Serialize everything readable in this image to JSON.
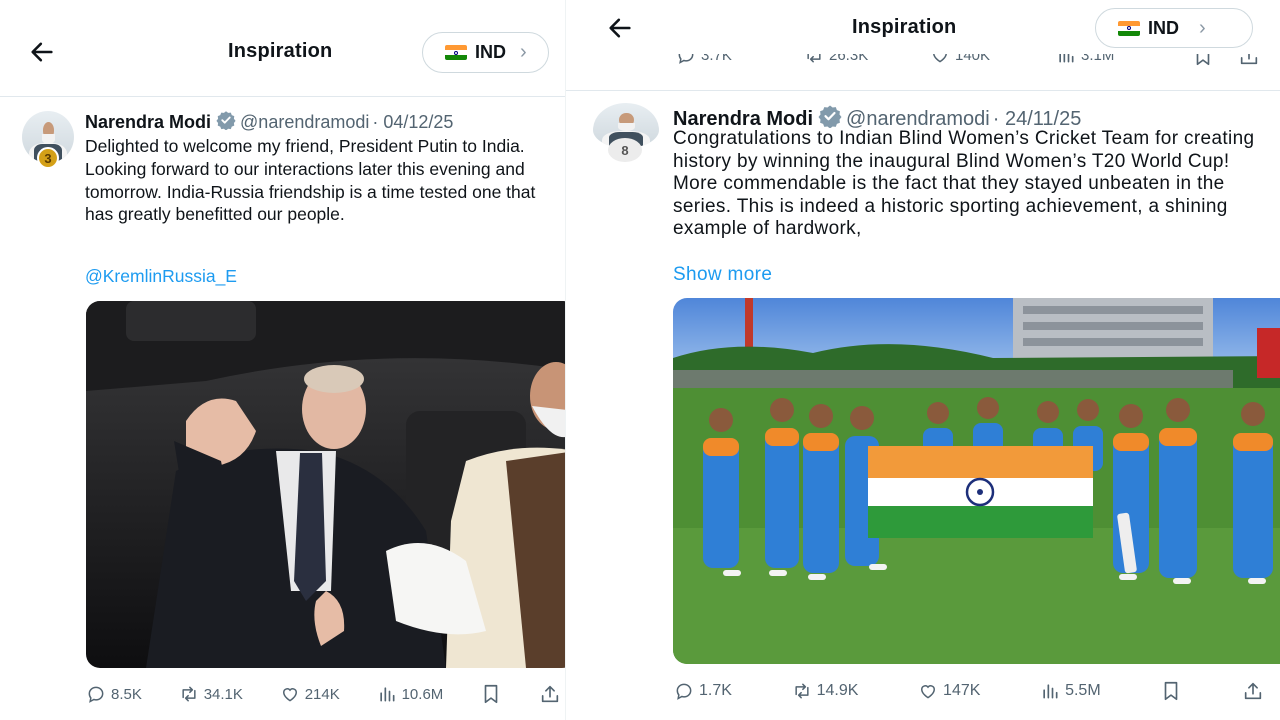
{
  "header": {
    "title": "Inspiration",
    "country_code": "IND",
    "flag": "flag-india",
    "back_icon": "arrow-left-icon",
    "chevron_icon": "chevron-right-icon"
  },
  "prev_tweet_stats": {
    "replies": "3.7K",
    "reposts": "26.3K",
    "likes": "140K",
    "views": "3.1M"
  },
  "tweets": [
    {
      "author": "Narendra Modi",
      "verified": true,
      "handle": "@narendramodi",
      "date": "· 04/12/25",
      "rank_badge": "3",
      "text": "Delighted to welcome my friend, President Putin to India. Looking forward to our interactions later this evening and tomorrow. India-Russia friendship is a time tested one that has greatly benefitted our people.",
      "mention": "@KremlinRussia_E",
      "media_description_icon": "photo-car-interior",
      "stats": {
        "replies": "8.5K",
        "reposts": "34.1K",
        "likes": "214K",
        "views": "10.6M"
      }
    },
    {
      "author": "Narendra Modi",
      "verified": true,
      "handle": "@narendramodi",
      "date": "· 24/11/25",
      "rank_badge": "8",
      "text": "Congratulations to Indian Blind Women’s Cricket Team for creating history by winning the inaugural Blind Women’s T20 World Cup! More commendable is the fact that they stayed unbeaten in the series. This is indeed a historic sporting achievement, a shining example of hardwork,",
      "show_more": "Show more",
      "media_description_icon": "photo-cricket-team",
      "stats": {
        "replies": "1.7K",
        "reposts": "14.9K",
        "likes": "147K",
        "views": "5.5M"
      }
    }
  ],
  "colors": {
    "accent": "#1d9bf0",
    "muted": "#536471",
    "verified": "#829aab",
    "gold_badge": "#d4a017"
  }
}
